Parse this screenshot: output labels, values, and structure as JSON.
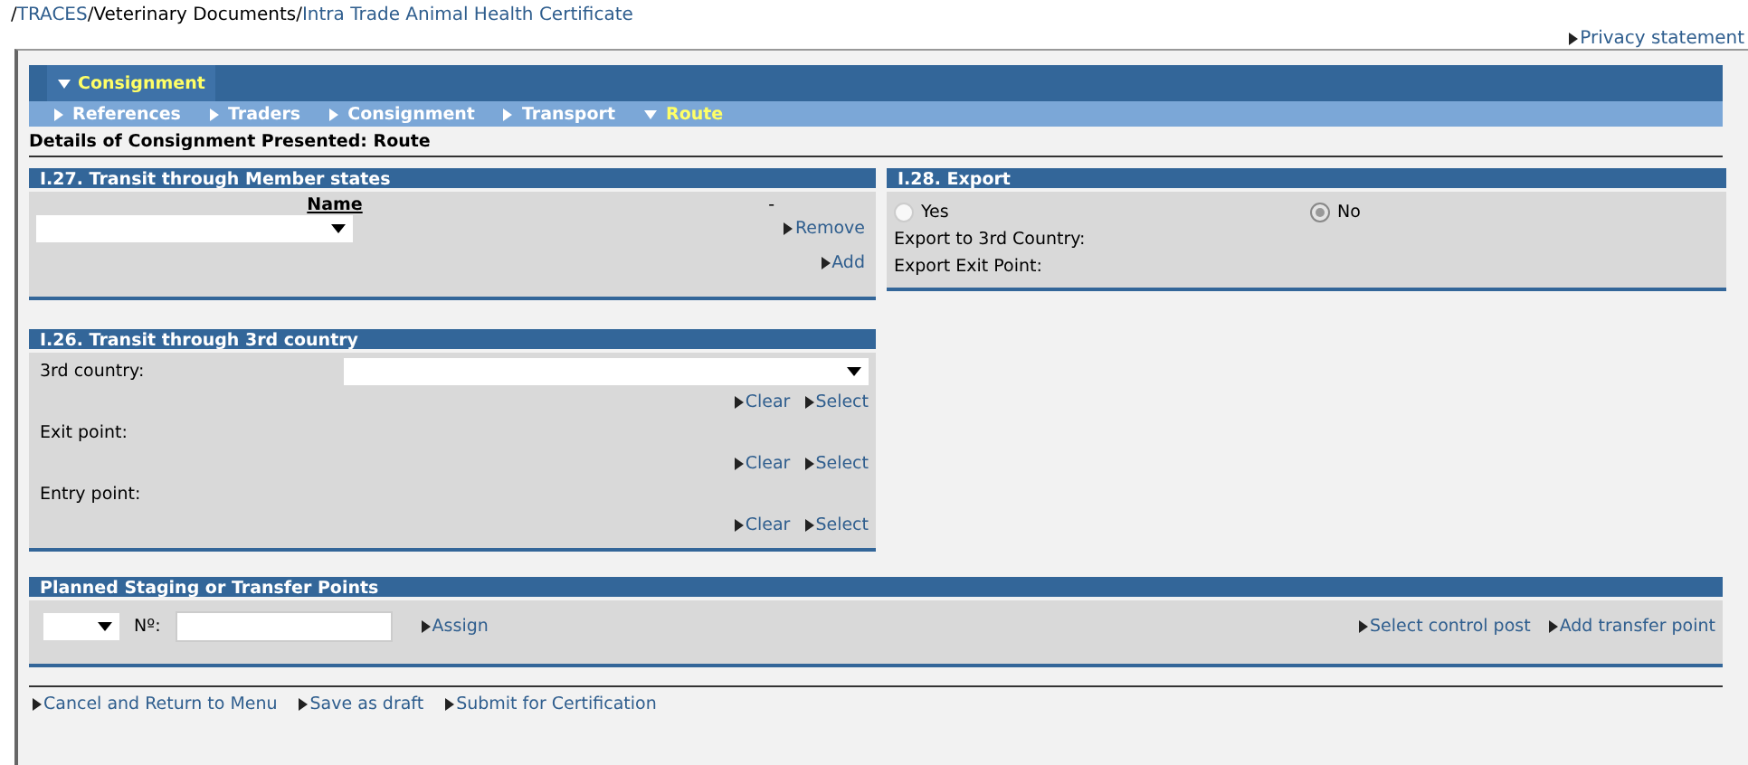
{
  "breadcrumb": {
    "separator": "/",
    "items": [
      {
        "label": "TRACES",
        "kind": "link"
      },
      {
        "label": "Veterinary Documents",
        "kind": "text"
      },
      {
        "label": "Intra Trade Animal Health Certificate",
        "kind": "link"
      }
    ]
  },
  "privacy_link": "Privacy statement",
  "main_tabs": [
    {
      "label": "Consignment",
      "selected": true
    }
  ],
  "sub_tabs": [
    {
      "label": "References",
      "selected": false
    },
    {
      "label": "Traders",
      "selected": false
    },
    {
      "label": "Consignment",
      "selected": false
    },
    {
      "label": "Transport",
      "selected": false
    },
    {
      "label": "Route",
      "selected": true
    }
  ],
  "page_title": "Details of Consignment Presented: Route",
  "member_states": {
    "title": "I.27. Transit through Member states",
    "column_1": "Name",
    "column_2": "-",
    "links": [
      "Remove",
      "Add"
    ]
  },
  "export": {
    "title": "I.28. Export",
    "options": [
      {
        "label": "Yes",
        "selected": false
      },
      {
        "label": "No",
        "selected": true
      }
    ],
    "fields": [
      "Export to 3rd Country:",
      "Export Exit Point:"
    ]
  },
  "third_country": {
    "title": "I.26. Transit through 3rd country",
    "rows": [
      {
        "label": "3rd country:",
        "kind": "select",
        "links": [
          "Clear",
          "Select"
        ]
      },
      {
        "label": "Exit point:",
        "kind": "text",
        "links": [
          "Clear",
          "Select"
        ]
      },
      {
        "label": "Entry point:",
        "kind": "text",
        "links": [
          "Clear",
          "Select"
        ]
      }
    ]
  },
  "staging": {
    "title": "Planned Staging or Transfer Points",
    "number_label": "Nº:",
    "assign": "Assign",
    "links": [
      "Select control post",
      "Add transfer point"
    ]
  },
  "actions": [
    "Cancel and Return to Menu",
    "Save as draft",
    "Submit for Certification"
  ]
}
